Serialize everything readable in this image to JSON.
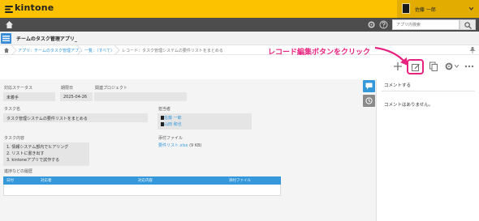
{
  "topbar": {
    "brand": "kintone",
    "user_name": "佐藤 一郎"
  },
  "header": {
    "search_placeholder": "アプリ内検索"
  },
  "app": {
    "title": "チームのタスク管理アプリ_"
  },
  "breadcrumb": {
    "items": [
      "アプリ：チームのタスク管理アプ...",
      "一覧：（すべて）",
      "レコード：タスク管理システムの要件リストをまとめる"
    ]
  },
  "annotation": {
    "text": "レコード編集ボタンをクリック",
    "color": "#e8227f"
  },
  "record": {
    "status_label": "対応ステータス",
    "status_value": "未着手",
    "due_label": "期限日",
    "due_value": "2025-04-26",
    "project_label": "関連プロジェクト",
    "project_value": "",
    "task_label": "タスク名",
    "task_value": "タスク管理システムの要件リストをまとめる",
    "assignee_label": "担当者",
    "assignees": [
      "佐藤 一郎",
      "山田 和也"
    ],
    "detail_label": "タスク内容",
    "detail_lines": [
      "1.  情報システム部内でヒアリング",
      "2.  リストに書き出す",
      "3.  kintoneアプリで試作する"
    ],
    "file_label": "添付ファイル",
    "file_name": "要件リスト.xlsx",
    "file_size": "(9 KB)",
    "history_label": "進捗などの履歴",
    "history_columns": [
      "日付",
      "対応者",
      "対応内容",
      "添付ファイル"
    ]
  },
  "comments": {
    "title": "コメントする",
    "empty_text": "コメントはありません。"
  },
  "colors": {
    "brand_yellow": "#fcc200",
    "dark_header": "#4d4d4d",
    "accent_blue": "#3498db",
    "side_blue": "#3498db",
    "side_gray": "#8a8a8a"
  }
}
